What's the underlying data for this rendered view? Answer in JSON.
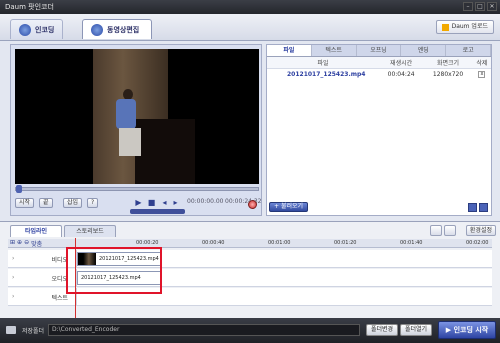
{
  "app": {
    "title": "Daum 팟인코더"
  },
  "modes": {
    "encode": "인코딩",
    "edit": "동영상편집"
  },
  "daum_upload": "Daum 업로드",
  "player": {
    "btn_cut": "시작",
    "btn_mark_in": "끝",
    "btn_insert": "삽입",
    "btn_help": "?",
    "time_current": "00:00:00.00",
    "time_total": "00:00:24.32"
  },
  "panel": {
    "tabs": [
      "파일",
      "텍스트",
      "오프닝",
      "엔딩",
      "로고"
    ],
    "columns": [
      "파일",
      "재생시간",
      "화면크기",
      "삭제"
    ],
    "files": [
      {
        "name": "20121017_125423.mp4",
        "duration": "00:04:24",
        "size": "1280x720",
        "delete": "x"
      }
    ],
    "add_button": "불러오기"
  },
  "timeline": {
    "tabs": [
      "타임라인",
      "스토리보드"
    ],
    "settings_button": "환경설정",
    "zoom_fit": "맞춤",
    "ticks": [
      "00:00:20",
      "00:00:40",
      "00:01:00",
      "00:01:20",
      "00:01:40",
      "00:02:00"
    ],
    "tracks": [
      {
        "label": "비디오",
        "clip": "20121017_125423.mp4"
      },
      {
        "label": "오디오",
        "clip": "20121017_125423.mp4"
      },
      {
        "label": "텍스트",
        "clip": ""
      }
    ]
  },
  "status": {
    "save_label": "저장폴더",
    "save_path": "D:\\Converted_Encoder",
    "change_button": "폴더변경",
    "open_button": "폴더열기",
    "start_button": "인코딩 시작"
  }
}
